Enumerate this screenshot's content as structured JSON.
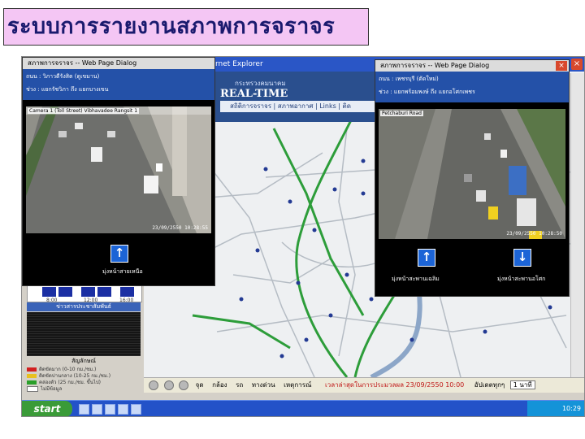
{
  "slide": {
    "title": "ระบบการรายงานสภาพการจราจร"
  },
  "ie": {
    "title_fragment": "rnet Explorer",
    "close_glyph": "×",
    "web_header": {
      "subtitle": "กระทรวงคมนาคม",
      "brand": "REAL-TIME",
      "nav": "สถิติการจราจร | สภาพอากาศ | Links | ติด"
    },
    "left_panel": {
      "chart_ticks": [
        "8:00",
        "12:00",
        "16:00"
      ],
      "news_header": "ข่าวสารประชาสัมพันธ์",
      "legend_title": "สัญลักษณ์",
      "legend": [
        {
          "label": "ติดขัดมาก (0-10 กม./ชม.)",
          "color": "#d22020"
        },
        {
          "label": "ติดขัดปานกลาง (10-25 กม./ชม.)",
          "color": "#e8c020"
        },
        {
          "label": "คล่องตัว (25 กม./ชม. ขึ้นไป)",
          "color": "#2aa02a"
        },
        {
          "label": "ไม่มีข้อมูล",
          "color": "#ffffff"
        }
      ]
    },
    "status_bar": {
      "items": [
        "จุด",
        "กล้อง",
        "รถ",
        "ทางด่วน",
        "เหตุการณ์"
      ],
      "updated": "เวลาล่าสุดในการประมวลผล 23/09/2550 10:00",
      "update_label": "อัปเดตทุกๆ",
      "update_value": "1 นาที"
    }
  },
  "taskbar": {
    "start_label": "start",
    "clock": "10:29"
  },
  "dialog_left": {
    "title": "สภาพการจราจร -- Web Page Dialog",
    "location": "ถนน : วิภาวดีรังสิต (ดูเขมาน)",
    "section": "ช่วง : แยกรัชวิภา ถึง แยกบางเขน",
    "camera_label": "Camera 1 (Toll Street) Vibhavadee Rangsit 1",
    "timestamp": "23/09/2550 10:28:55",
    "direction_label": "มุ่งหน้าสายเหนือ",
    "arrow": "↑"
  },
  "dialog_right": {
    "title": "สภาพการจราจร -- Web Page Dialog",
    "location": "ถนน : เพชรบุรี (ตัดใหม่)",
    "section": "ช่วง : แยกพร้อมพงษ์ ถึง แยกอโศกเพชร",
    "camera_label": "Petchaburi Road",
    "timestamp": "23/09/2550 10:28:50",
    "direction_label_1": "มุ่งหน้าสะพานเฉลิม",
    "direction_label_2": "มุ่งหน้าสะพานอโศก",
    "arrow_1": "↑",
    "arrow_2": "↓",
    "close_glyph": "×"
  }
}
